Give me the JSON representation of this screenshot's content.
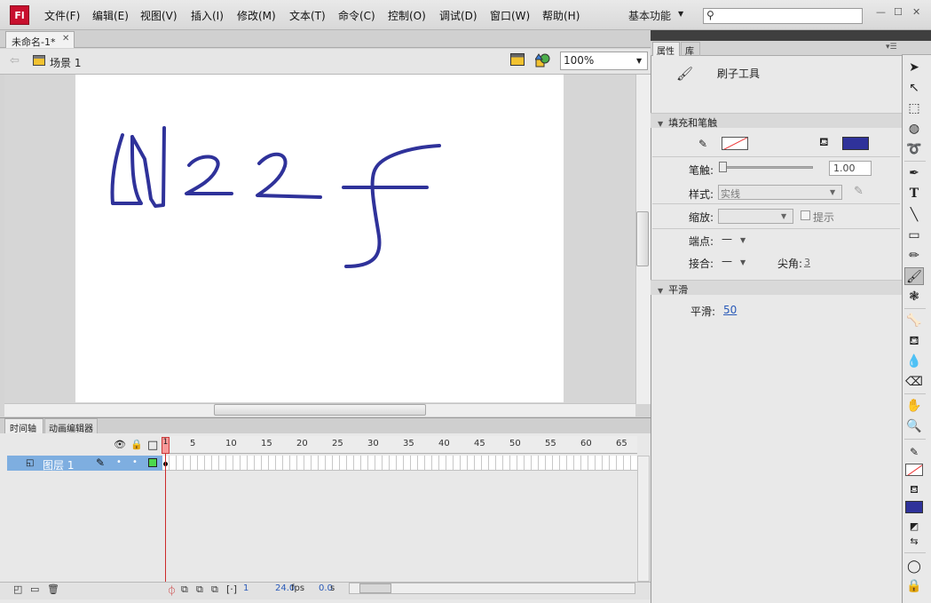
{
  "app": {
    "logo": "Fl",
    "menu": [
      "文件(F)",
      "编辑(E)",
      "视图(V)",
      "插入(I)",
      "修改(M)",
      "文本(T)",
      "命令(C)",
      "控制(O)",
      "调试(D)",
      "窗口(W)",
      "帮助(H)"
    ],
    "workspace": "基本功能",
    "search_placeholder": ""
  },
  "document": {
    "tab_title": "未命名-1*",
    "scene_label": "场景 1",
    "zoom": "100%",
    "stroke_color": "#2f329a"
  },
  "timeline": {
    "tabs": [
      "时间轴",
      "动画编辑器"
    ],
    "ruler": [
      "1",
      "5",
      "10",
      "15",
      "20",
      "25",
      "30",
      "35",
      "40",
      "45",
      "50",
      "55",
      "60",
      "65"
    ],
    "layer_name": "图层 1",
    "current_frame": "1",
    "fps": "24.0",
    "fps_unit": "fps",
    "time": "0.0",
    "time_unit": "s"
  },
  "properties": {
    "tabs": [
      "属性",
      "库"
    ],
    "tool_name": "刷子工具",
    "section_fill_stroke": "填充和笔触",
    "stroke_label": "笔触:",
    "stroke_value": "1.00",
    "style_label": "样式:",
    "style_value": "实线",
    "scale_label": "缩放:",
    "hint_label": "提示",
    "cap_label": "端点:",
    "cap_value": "—",
    "join_label": "接合:",
    "join_value": "—",
    "miter_label": "尖角:",
    "miter_value": "3",
    "section_smooth": "平滑",
    "smooth_label": "平滑:",
    "smooth_value": "50",
    "fill_color": "#2f329a"
  }
}
